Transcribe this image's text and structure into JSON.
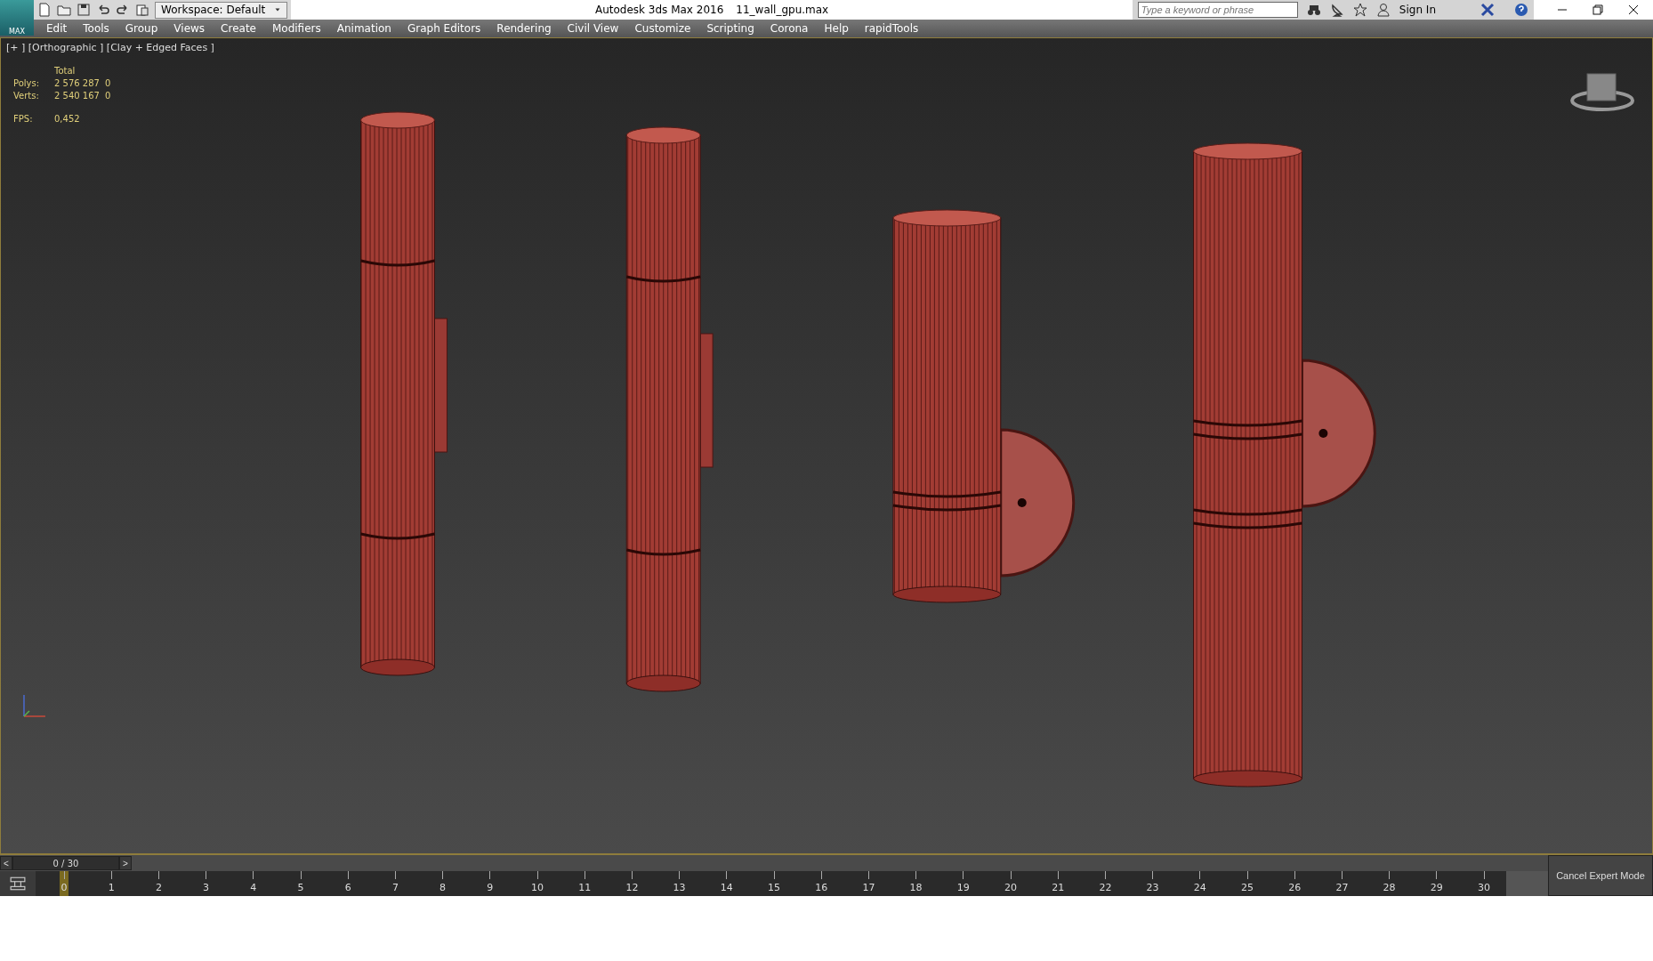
{
  "title_bar": {
    "app_badge": "MAX",
    "workspace": "Workspace: Default",
    "app_title": "Autodesk 3ds Max 2016",
    "file_name": "11_wall_gpu.max",
    "search": {
      "placeholder": "Type a keyword or phrase"
    },
    "sign_in": "Sign In"
  },
  "menu": [
    "Edit",
    "Tools",
    "Group",
    "Views",
    "Create",
    "Modifiers",
    "Animation",
    "Graph Editors",
    "Rendering",
    "Civil View",
    "Customize",
    "Scripting",
    "Corona",
    "Help",
    "rapidTools"
  ],
  "viewport": {
    "label": "[+ ] [Orthographic ] [Clay + Edged Faces ]",
    "stats_header": "Total",
    "stats": [
      {
        "label": "Polys:",
        "value": "2 576 287",
        "value_2": "0"
      },
      {
        "label": "Verts:",
        "value": "2 540 167",
        "value_2": "0"
      }
    ],
    "fps_label": "FPS:",
    "fps_value": "0,452"
  },
  "time_slider": {
    "prev": "<",
    "position": "0 / 30",
    "next": ">"
  },
  "timeline": {
    "ticks": [
      {
        "label": "0",
        "selected": true
      },
      {
        "label": "1",
        "selected": false
      },
      {
        "label": "2",
        "selected": false
      },
      {
        "label": "3",
        "selected": false
      },
      {
        "label": "4",
        "selected": false
      },
      {
        "label": "5",
        "selected": false
      },
      {
        "label": "6",
        "selected": false
      },
      {
        "label": "7",
        "selected": false
      },
      {
        "label": "8",
        "selected": false
      },
      {
        "label": "9",
        "selected": false
      },
      {
        "label": "10",
        "selected": false
      },
      {
        "label": "11",
        "selected": false
      },
      {
        "label": "12",
        "selected": false
      },
      {
        "label": "13",
        "selected": false
      },
      {
        "label": "14",
        "selected": false
      },
      {
        "label": "15",
        "selected": false
      },
      {
        "label": "16",
        "selected": false
      },
      {
        "label": "17",
        "selected": false
      },
      {
        "label": "18",
        "selected": false
      },
      {
        "label": "19",
        "selected": false
      },
      {
        "label": "20",
        "selected": false
      },
      {
        "label": "21",
        "selected": false
      },
      {
        "label": "22",
        "selected": false
      },
      {
        "label": "23",
        "selected": false
      },
      {
        "label": "24",
        "selected": false
      },
      {
        "label": "25",
        "selected": false
      },
      {
        "label": "26",
        "selected": false
      },
      {
        "label": "27",
        "selected": false
      },
      {
        "label": "28",
        "selected": false
      },
      {
        "label": "29",
        "selected": false
      },
      {
        "label": "30",
        "selected": false
      }
    ]
  },
  "expert_mode_button": "Cancel Expert Mode"
}
